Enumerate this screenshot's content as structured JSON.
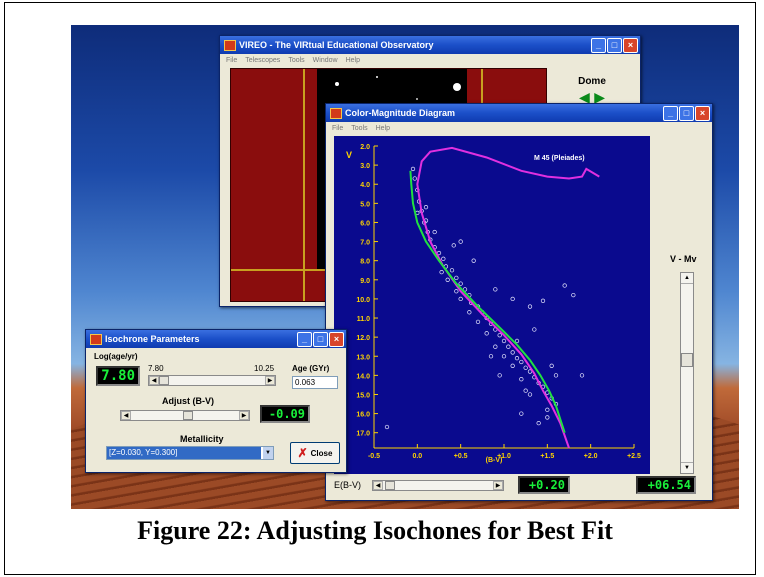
{
  "caption": "Figure 22: Adjusting Isochones for Best Fit",
  "vireo": {
    "title": "VIREO - The VIRtual Educational Observatory",
    "menu": [
      "File",
      "Telescopes",
      "Tools",
      "Window",
      "Help"
    ],
    "dome_label": "Dome"
  },
  "cmd": {
    "title": "Color-Magnitude Diagram",
    "menu": [
      "File",
      "Tools",
      "Help"
    ],
    "ylabel": "V",
    "xlabel": "(B-V)",
    "cluster_label": "M 45 (Pleiades)",
    "vmv_label": "V - Mv",
    "ebv_label": "E(B-V)",
    "ebv_value": "+0.20",
    "vmv_value": "+06.54"
  },
  "iso": {
    "title": "Isochrone Parameters",
    "log_age_label": "Log(age/yr)",
    "log_age_value": "7.80",
    "slider_min": "7.80",
    "slider_max": "10.25",
    "age_label": "Age (GYr)",
    "age_value": "0.063",
    "adjust_label": "Adjust (B-V)",
    "adjust_value": "-0.09",
    "metallicity_label": "Metallicity",
    "metallicity_value": "[Z=0.030, Y=0.300]",
    "close_label": "Close",
    "adjust_slider_level": 0.52,
    "age_slider_level": 0.0
  },
  "colors": {
    "isochrone_magenta": "#e030e0",
    "isochrone_green": "#20e040",
    "plot_bg": "#0a0a8e",
    "lcd_green": "#19f03a"
  },
  "chart_data": {
    "type": "scatter",
    "title": "M 45 (Pleiades)",
    "xlabel": "(B-V)",
    "ylabel": "V",
    "xlim": [
      -0.5,
      2.5
    ],
    "ylim": [
      17.8,
      2.0
    ],
    "x_ticks": [
      "-0.5",
      "0.0",
      "+0.5",
      "+1.0",
      "+1.5",
      "+2.0",
      "+2.5"
    ],
    "y_ticks": [
      "2.0",
      "3.0",
      "4.0",
      "5.0",
      "6.0",
      "7.0",
      "8.0",
      "9.0",
      "10.0",
      "11.0",
      "12.0",
      "13.0",
      "14.0",
      "15.0",
      "16.0",
      "17.0"
    ],
    "stars": [
      [
        -0.05,
        3.2
      ],
      [
        -0.03,
        3.7
      ],
      [
        0.0,
        4.3
      ],
      [
        0.02,
        4.9
      ],
      [
        0.05,
        5.4
      ],
      [
        0.1,
        5.2
      ],
      [
        0.08,
        6.0
      ],
      [
        0.12,
        6.5
      ],
      [
        0.15,
        6.9
      ],
      [
        0.2,
        7.3
      ],
      [
        0.25,
        7.6
      ],
      [
        0.3,
        7.9
      ],
      [
        0.33,
        8.3
      ],
      [
        0.4,
        8.5
      ],
      [
        0.45,
        8.9
      ],
      [
        0.5,
        9.2
      ],
      [
        0.55,
        9.5
      ],
      [
        0.6,
        9.8
      ],
      [
        0.62,
        10.2
      ],
      [
        0.7,
        10.4
      ],
      [
        0.75,
        10.7
      ],
      [
        0.8,
        11.0
      ],
      [
        0.85,
        11.3
      ],
      [
        0.9,
        11.6
      ],
      [
        0.95,
        11.9
      ],
      [
        1.0,
        12.2
      ],
      [
        1.05,
        12.5
      ],
      [
        1.1,
        12.8
      ],
      [
        1.15,
        13.1
      ],
      [
        1.2,
        13.3
      ],
      [
        1.25,
        13.6
      ],
      [
        1.3,
        13.8
      ],
      [
        1.35,
        14.1
      ],
      [
        1.4,
        14.4
      ],
      [
        1.45,
        14.6
      ],
      [
        1.5,
        14.9
      ],
      [
        1.55,
        15.2
      ],
      [
        1.6,
        15.5
      ],
      [
        1.3,
        15.0
      ],
      [
        1.2,
        14.2
      ],
      [
        1.1,
        13.5
      ],
      [
        1.0,
        13.0
      ],
      [
        0.9,
        12.5
      ],
      [
        0.8,
        11.8
      ],
      [
        0.7,
        11.2
      ],
      [
        0.6,
        10.7
      ],
      [
        0.5,
        10.0
      ],
      [
        0.45,
        9.6
      ],
      [
        0.35,
        9.0
      ],
      [
        0.28,
        8.6
      ],
      [
        0.5,
        7.0
      ],
      [
        0.42,
        7.2
      ],
      [
        0.65,
        8.0
      ],
      [
        0.9,
        9.5
      ],
      [
        1.1,
        10.0
      ],
      [
        1.3,
        10.4
      ],
      [
        1.45,
        10.1
      ],
      [
        1.7,
        9.3
      ],
      [
        1.8,
        9.8
      ],
      [
        1.9,
        14.0
      ],
      [
        1.2,
        16.0
      ],
      [
        1.4,
        16.5
      ],
      [
        1.5,
        15.8
      ],
      [
        0.1,
        5.9
      ],
      [
        0.2,
        6.5
      ],
      [
        0.0,
        5.5
      ],
      [
        1.35,
        11.6
      ],
      [
        1.55,
        13.5
      ],
      [
        1.6,
        14.0
      ],
      [
        1.25,
        14.8
      ],
      [
        1.5,
        16.2
      ],
      [
        -0.35,
        16.7
      ],
      [
        0.95,
        14.0
      ],
      [
        1.15,
        12.2
      ],
      [
        0.85,
        13.0
      ]
    ],
    "isochrone_magenta": [
      [
        2.1,
        3.6
      ],
      [
        1.95,
        3.2
      ],
      [
        1.9,
        3.6
      ],
      [
        1.75,
        3.7
      ],
      [
        1.5,
        3.6
      ],
      [
        1.2,
        3.3
      ],
      [
        0.8,
        2.6
      ],
      [
        0.4,
        2.1
      ],
      [
        0.15,
        2.3
      ],
      [
        0.05,
        2.8
      ],
      [
        0.0,
        4.0
      ],
      [
        0.05,
        5.5
      ],
      [
        0.15,
        7.0
      ],
      [
        0.3,
        8.3
      ],
      [
        0.5,
        9.6
      ],
      [
        0.75,
        10.8
      ],
      [
        1.0,
        11.9
      ],
      [
        1.2,
        12.9
      ],
      [
        1.35,
        13.9
      ],
      [
        1.45,
        14.8
      ],
      [
        1.55,
        15.6
      ],
      [
        1.65,
        16.5
      ],
      [
        1.75,
        17.8
      ]
    ],
    "isochrone_green": [
      [
        -0.08,
        3.3
      ],
      [
        -0.07,
        4.0
      ],
      [
        -0.05,
        5.0
      ],
      [
        0.0,
        6.0
      ],
      [
        0.1,
        7.0
      ],
      [
        0.25,
        8.0
      ],
      [
        0.45,
        9.2
      ],
      [
        0.7,
        10.4
      ],
      [
        0.95,
        11.5
      ],
      [
        1.15,
        12.4
      ],
      [
        1.3,
        13.2
      ],
      [
        1.42,
        14.0
      ],
      [
        1.52,
        14.8
      ],
      [
        1.6,
        15.6
      ],
      [
        1.65,
        16.3
      ],
      [
        1.7,
        17.0
      ]
    ]
  }
}
